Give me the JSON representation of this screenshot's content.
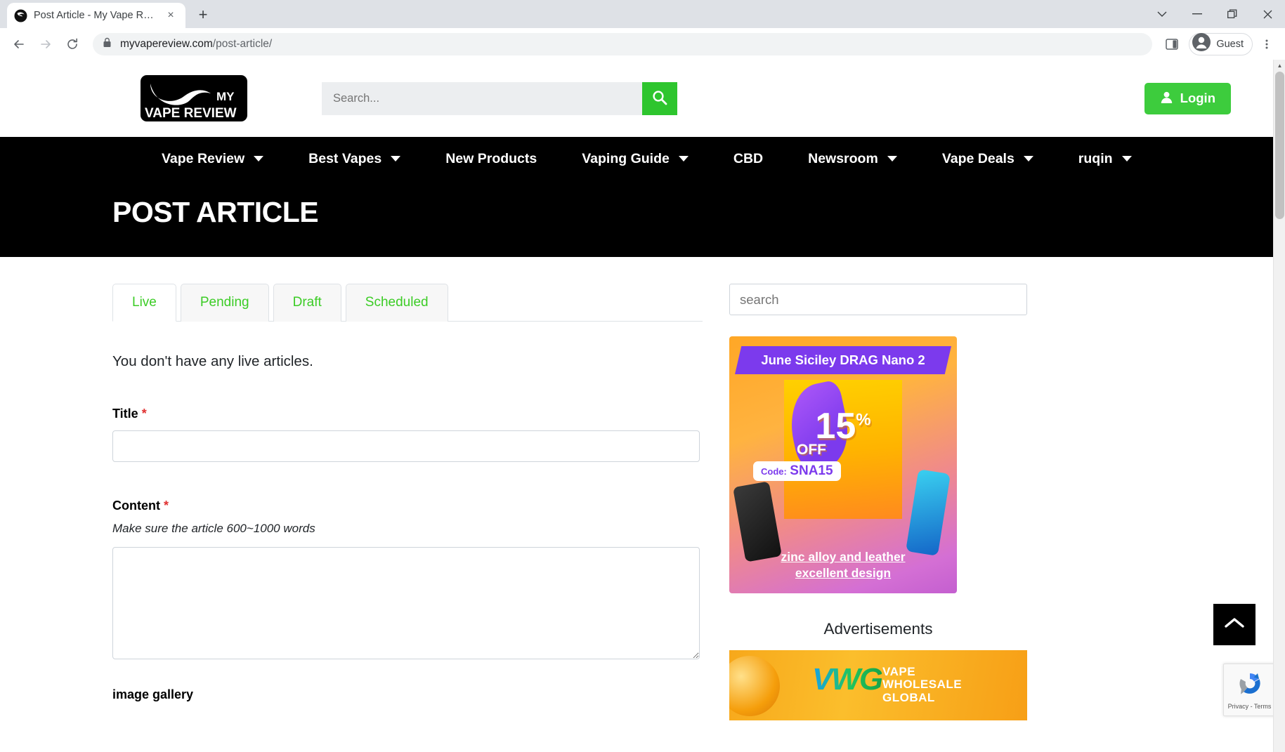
{
  "browser": {
    "tab_title": "Post Article - My Vape Review",
    "new_tab_label": "+",
    "close_label": "×",
    "url_domain": "myvapereview.com",
    "url_path": "/post-article/",
    "profile_name": "Guest",
    "back_icon": "back-arrow-icon",
    "forward_icon": "forward-arrow-icon",
    "reload_icon": "reload-icon",
    "lock_icon": "lock-icon",
    "minimize_label": "—",
    "maximize_label": "❐",
    "close_window_label": "✕",
    "chevron_label": "⌄",
    "menu_label": "⋮"
  },
  "header": {
    "logo_line1": "MY",
    "logo_line2": "VAPE REVIEW",
    "search_placeholder": "Search...",
    "search_value": "",
    "search_button_icon": "search-icon",
    "login_label": "Login",
    "login_icon": "user-icon",
    "accent_green": "#3dcc3d"
  },
  "nav": {
    "items": [
      {
        "label": "Vape Review",
        "has_dropdown": true
      },
      {
        "label": "Best Vapes",
        "has_dropdown": true
      },
      {
        "label": "New Products",
        "has_dropdown": false
      },
      {
        "label": "Vaping Guide",
        "has_dropdown": true
      },
      {
        "label": "CBD",
        "has_dropdown": false
      },
      {
        "label": "Newsroom",
        "has_dropdown": true
      },
      {
        "label": "Vape Deals",
        "has_dropdown": true
      },
      {
        "label": "ruqin",
        "has_dropdown": true
      }
    ]
  },
  "page": {
    "title": "POST ARTICLE"
  },
  "main": {
    "tabs": [
      {
        "label": "Live",
        "active": true
      },
      {
        "label": "Pending",
        "active": false
      },
      {
        "label": "Draft",
        "active": false
      },
      {
        "label": "Scheduled",
        "active": false
      }
    ],
    "empty_message": "You don't have any live articles.",
    "title_label": "Title",
    "title_required": "*",
    "title_value": "",
    "title_placeholder": "",
    "content_label": "Content",
    "content_required": "*",
    "content_hint": "Make sure the article 600~1000 words",
    "content_value": "",
    "content_placeholder": "",
    "gallery_label": "image gallery"
  },
  "sidebar": {
    "search_placeholder": "search",
    "search_value": "",
    "ad_primary": {
      "ribbon": "June Siciley DRAG Nano 2",
      "percent": "15",
      "percent_symbol": "%",
      "off_label": "OFF",
      "code_label": "Code:",
      "code_value": "SNA15",
      "tagline_line1": "zinc alloy and leather",
      "tagline_line2": "excellent design"
    },
    "ads_heading": "Advertisements",
    "ad_secondary": {
      "logo_text": "VWG",
      "line1": "VAPE",
      "line2": "WHOLESALE",
      "line3": "GLOBAL"
    }
  },
  "widgets": {
    "scroll_top_icon": "chevron-up-icon",
    "recaptcha_icon": "recaptcha-icon",
    "recaptcha_text": "Privacy - Terms",
    "scrollbar_up": "▲",
    "scrollbar_down": "▼"
  }
}
